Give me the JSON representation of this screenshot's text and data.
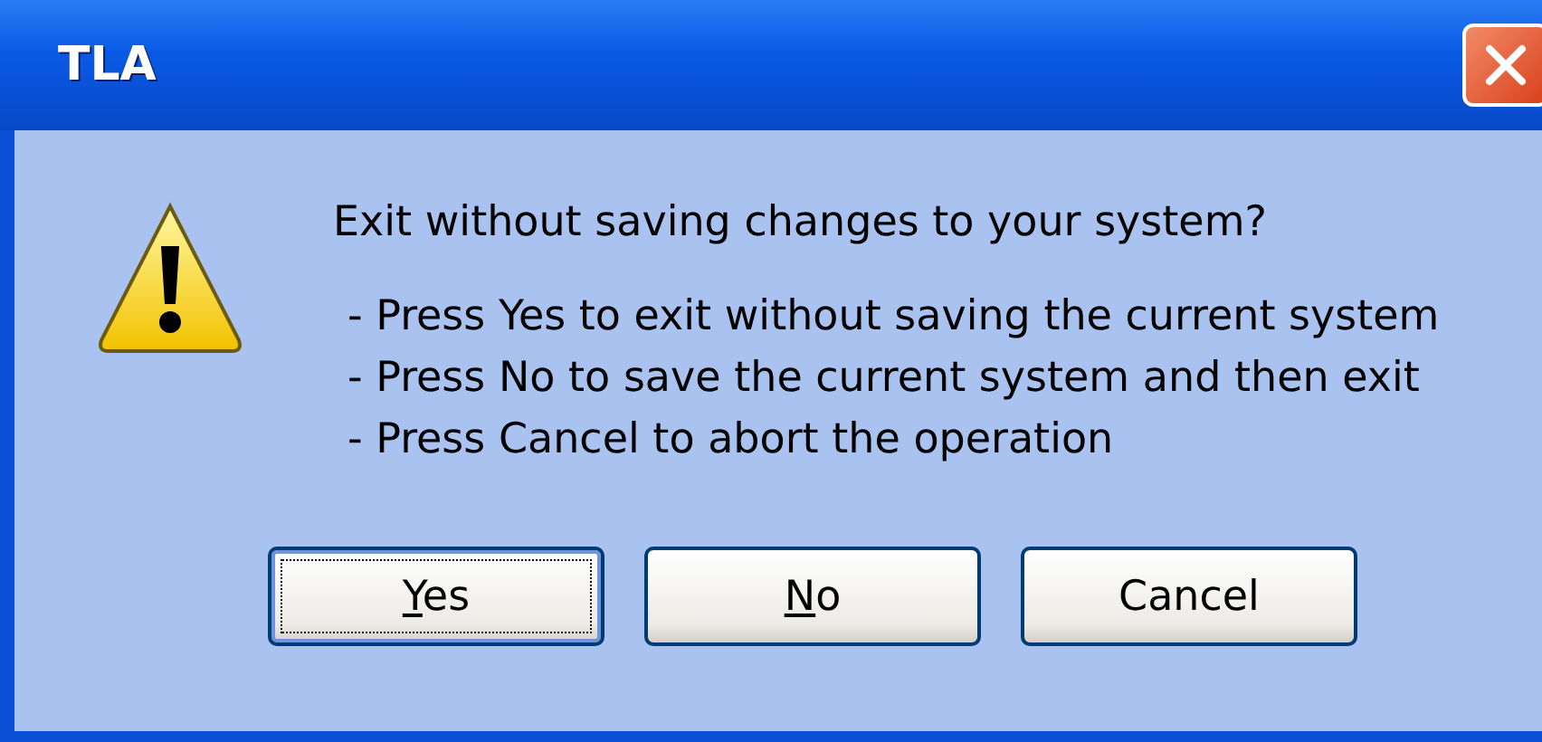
{
  "window": {
    "title": "TLA"
  },
  "message": {
    "heading": "Exit without saving changes to your system?",
    "lines": [
      "- Press Yes to exit without saving the current system",
      "- Press No to save the current system and then exit",
      "- Press Cancel to abort the operation"
    ]
  },
  "buttons": [
    {
      "label": "Yes",
      "access_key": true,
      "focused": true
    },
    {
      "label": "No",
      "access_key": true,
      "focused": false
    },
    {
      "label": "Cancel",
      "access_key": false,
      "focused": false
    }
  ]
}
